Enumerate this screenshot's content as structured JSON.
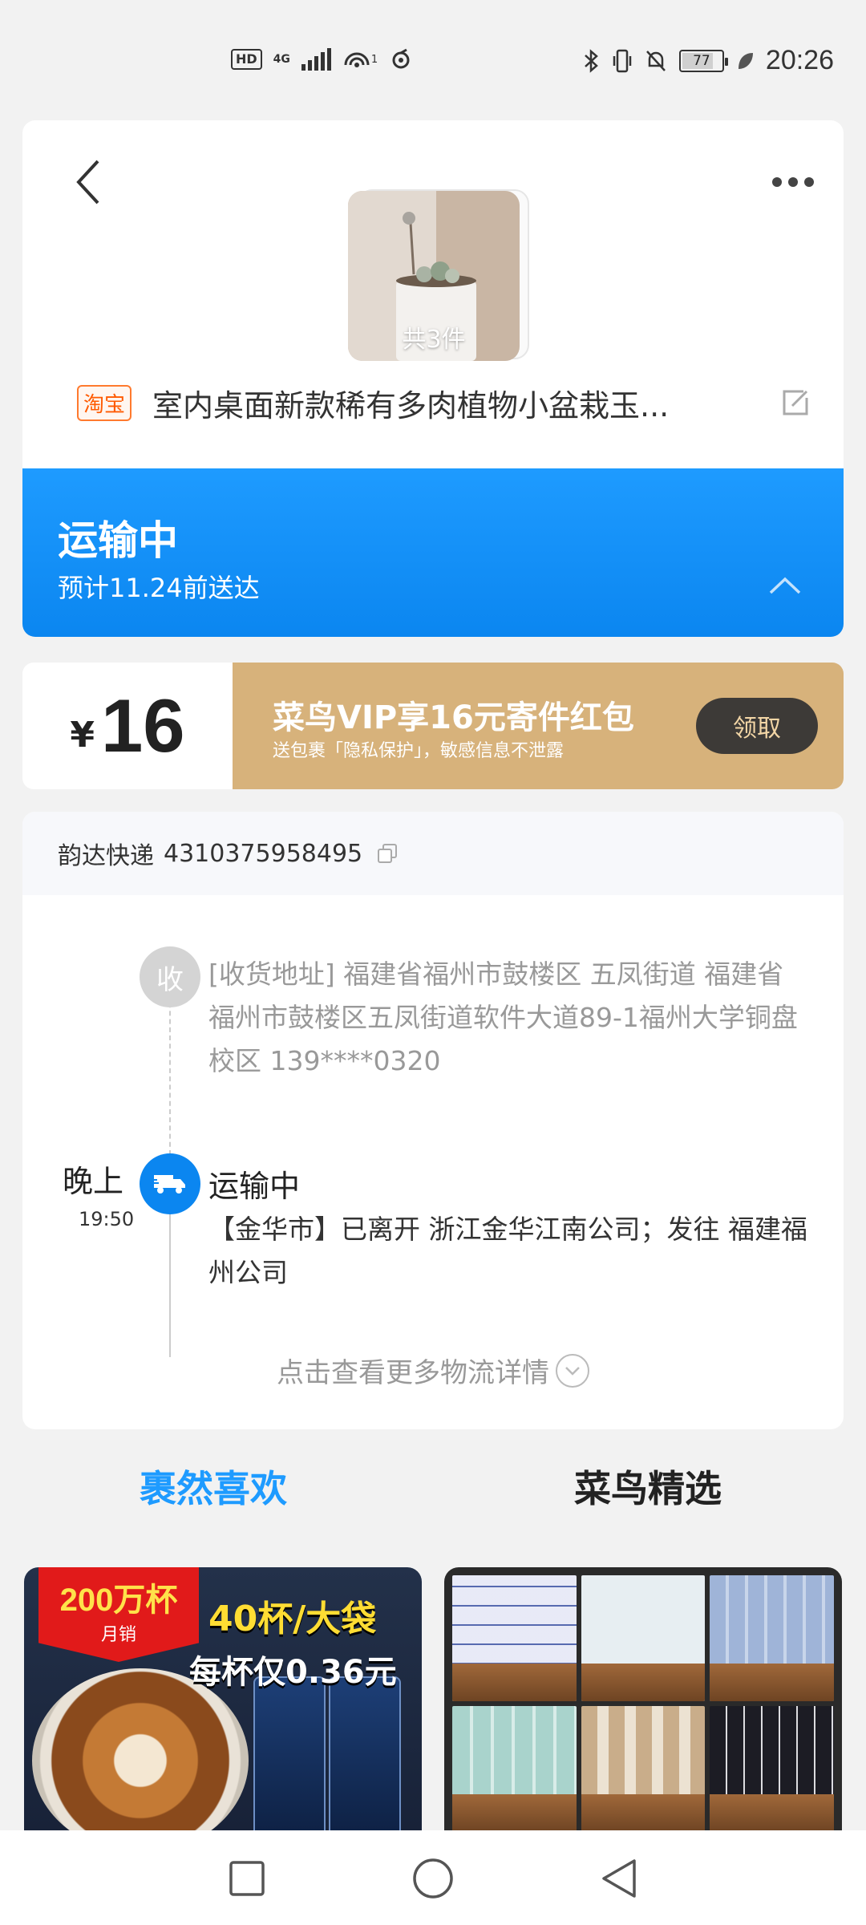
{
  "status_bar": {
    "hd": "HD",
    "network": "4G",
    "hotspot_sup": "1",
    "battery": "77",
    "time": "20:26"
  },
  "header": {
    "item_count": "共3件",
    "platform_tag": "淘宝",
    "product_title": "室内桌面新款稀有多肉植物小盆栽玉..."
  },
  "status_banner": {
    "title": "运输中",
    "eta": "预计11.24前送达",
    "color": "#0b86f0"
  },
  "coupon": {
    "currency": "¥",
    "amount": "16",
    "headline": "菜鸟VIP享16元寄件红包",
    "subtext": "送包裹「隐私保护」，敏感信息不泄露",
    "claim_label": "领取",
    "color": "#d7b27b"
  },
  "tracking": {
    "carrier": "韵达快递",
    "tracking_number": "4310375958495",
    "receive_badge": "收",
    "receive_address": "[收货地址] 福建省福州市鼓楼区 五凤街道   福建省福州市鼓楼区五凤街道软件大道89-1福州大学铜盘校区 139****0320",
    "event_period": "晚上",
    "event_time": "19:50",
    "event_status": "运输中",
    "event_detail": "【金华市】已离开 浙江金华江南公司；发往 福建福州公司",
    "more_label": "点击查看更多物流详情"
  },
  "tabs": [
    {
      "label": "裹然喜欢",
      "active": true
    },
    {
      "label": "菜鸟精选",
      "active": false
    }
  ],
  "recommend": {
    "coffee": {
      "badge_big": "200万杯",
      "badge_small": "月销",
      "promo_line1": "40杯/大袋",
      "promo_line2": "每杯仅0.36元"
    }
  },
  "icons": {
    "back": "chevron-left-icon",
    "more": "ellipsis-icon",
    "edit": "edit-icon",
    "collapse": "chevron-up-icon",
    "copy": "copy-icon",
    "truck": "truck-icon",
    "nav_recent": "square-icon",
    "nav_home": "circle-icon",
    "nav_back": "triangle-back-icon"
  }
}
